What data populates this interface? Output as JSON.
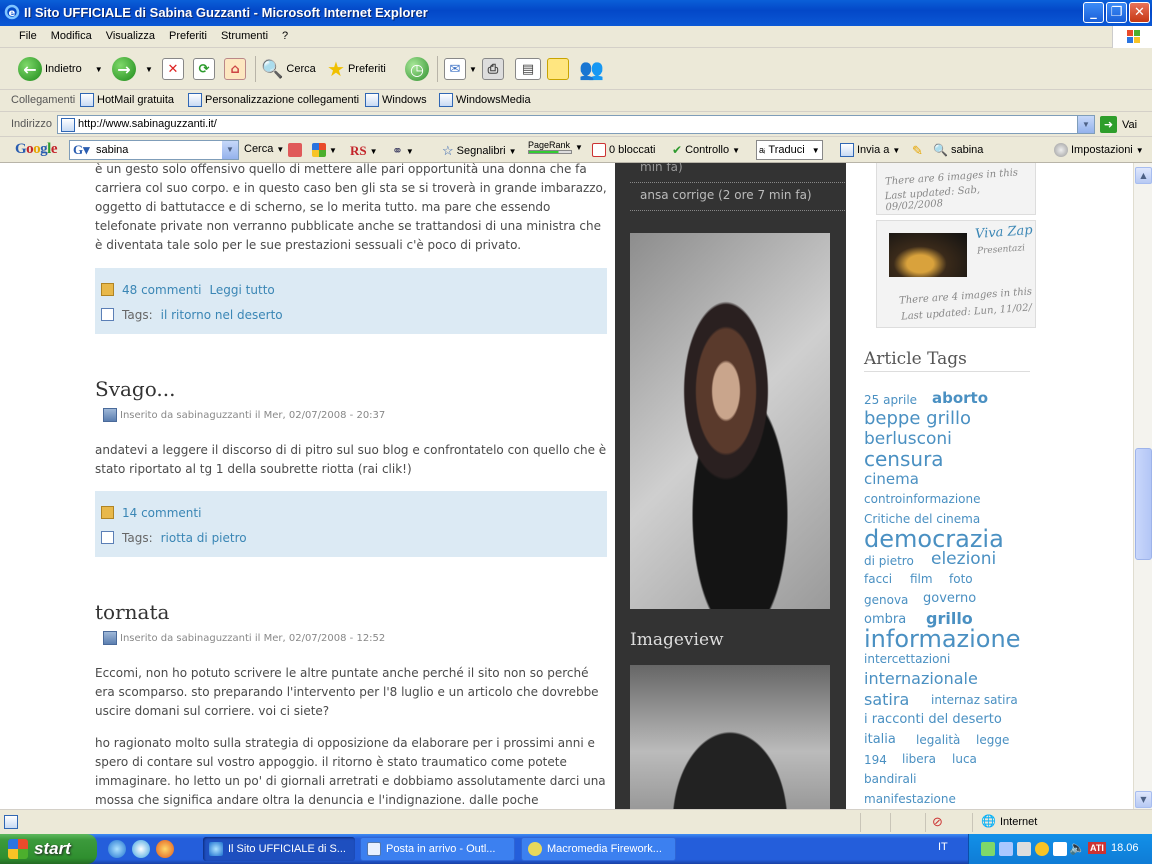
{
  "window": {
    "title": "Il Sito UFFICIALE di Sabina Guzzanti - Microsoft Internet Explorer",
    "minimize": "_",
    "maximize": "❐",
    "close": "✕"
  },
  "menu": [
    "File",
    "Modifica",
    "Visualizza",
    "Preferiti",
    "Strumenti",
    "?"
  ],
  "toolbar": {
    "back": "Indietro",
    "search": "Cerca",
    "favorites": "Preferiti"
  },
  "links": {
    "label": "Collegamenti",
    "items": [
      "HotMail gratuita",
      "Personalizzazione collegamenti",
      "Windows",
      "WindowsMedia"
    ]
  },
  "address": {
    "label": "Indirizzo",
    "url": "http://www.sabinaguzzanti.it/",
    "go": "Vai"
  },
  "google": {
    "logo": "Google",
    "query": "sabina",
    "search": "Cerca",
    "rs": "RS",
    "bookmarks": "Segnalibri",
    "pagerank": "PageRank",
    "blocked": "0 bloccati",
    "check": "Controllo",
    "translate": "Traduci",
    "send": "Invia a",
    "term": "sabina",
    "settings": "Impostazioni"
  },
  "posts": [
    {
      "tail_text": "è un gesto solo offensivo quello di mettere alle pari opportunità una donna che fa carriera col suo corpo. e in questo caso ben gli sta se si troverà in grande imbarazzo, oggetto di battutacce e di scherno, se lo merita tutto. ma pare che essendo telefonate private non verranno pubblicate anche se trattandosi di una ministra che è diventata tale solo per le sue prestazioni sessuali c'è poco di privato.",
      "comments": "48 commenti",
      "read_more": "Leggi tutto",
      "tags_label": "Tags:",
      "tags": "il ritorno nel deserto"
    },
    {
      "title": "Svago...",
      "posted": "Inserito da sabinaguzzanti il Mer, 02/07/2008 - 20:37",
      "body": "andatevi a leggere il discorso di di pitro sul suo blog e confrontatelo con quello che è stato riportato al tg 1 della soubrette riotta (rai clik!)",
      "comments": "14 commenti",
      "tags_label": "Tags:",
      "tags": "riotta di pietro"
    },
    {
      "title": "tornata",
      "posted": "Inserito da sabinaguzzanti il Mer, 02/07/2008 - 12:52",
      "body1": "Eccomi, non ho potuto scrivere le altre puntate anche perché il sito non so perché era scomparso. sto preparando l'intervento per l'8 luglio e un articolo che dovrebbe uscire domani sul corriere. voi ci siete?",
      "body2": "ho ragionato molto sulla strategia di opposizione da elaborare per i prossimi anni e spero di contare sul vostro appoggio. il ritorno è stato traumatico come potete immaginare. ho letto un po' di giornali arretrati e dobbiamo assolutamente darci una mossa che significa andare oltra la denuncia e l'indignazione. dalle poche conversazioni"
    }
  ],
  "middle": {
    "top_fragment": "min fa)",
    "news_item": "ansa corrige (2 ore 7 min fa)",
    "imageview": "Imageview"
  },
  "right": {
    "gallery1": {
      "count": "There are 6 images in this",
      "updated": "Last updated: Sab, 09/02/2008"
    },
    "gallery2": {
      "title": "Viva Zap",
      "sub": "Presentazi",
      "count": "There are 4 images in this",
      "updated": "Last updated: Lun, 11/02/"
    },
    "tags_title": "Article Tags",
    "tags": [
      "25 aprile",
      "aborto",
      "beppe grillo",
      "berlusconi",
      "censura",
      "cinema",
      "controinformazione",
      "Critiche del cinema",
      "democrazia",
      "di pietro",
      "elezioni",
      "facci",
      "film",
      "foto",
      "genova",
      "governo",
      "ombra",
      "grillo",
      "informazione",
      "intercettazioni",
      "internazionale",
      "satira",
      "internaz satira",
      "i racconti del deserto",
      "italia",
      "legalità",
      "legge",
      "194",
      "libera",
      "luca",
      "bandirali",
      "manifestazione"
    ]
  },
  "status": {
    "zone": "Internet"
  },
  "taskbar": {
    "start": "start",
    "tasks": [
      "Il Sito UFFICIALE di S...",
      "Posta in arrivo - Outl...",
      "Macromedia Firework..."
    ],
    "lang": "IT",
    "clock": "18.06",
    "ati": "ATI"
  }
}
